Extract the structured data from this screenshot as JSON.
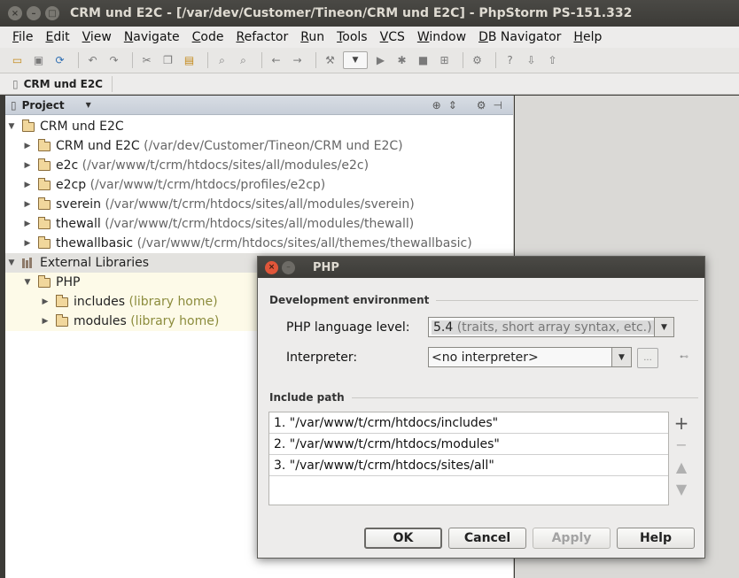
{
  "window": {
    "title": "CRM und E2C - [/var/dev/Customer/Tineon/CRM und E2C] - PhpStorm PS-151.332"
  },
  "menu": [
    "File",
    "Edit",
    "View",
    "Navigate",
    "Code",
    "Refactor",
    "Run",
    "Tools",
    "VCS",
    "Window",
    "DB Navigator",
    "Help"
  ],
  "navbar": {
    "crumb": "CRM und E2C"
  },
  "project_panel": {
    "title": "Project",
    "root": "CRM und E2C",
    "items": [
      {
        "name": "CRM und E2C",
        "path": "(/var/dev/Customer/Tineon/CRM und E2C)"
      },
      {
        "name": "e2c",
        "path": "(/var/www/t/crm/htdocs/sites/all/modules/e2c)"
      },
      {
        "name": "e2cp",
        "path": "(/var/www/t/crm/htdocs/profiles/e2cp)"
      },
      {
        "name": "sverein",
        "path": "(/var/www/t/crm/htdocs/sites/all/modules/sverein)"
      },
      {
        "name": "thewall",
        "path": "(/var/www/t/crm/htdocs/sites/all/modules/thewall)"
      },
      {
        "name": "thewallbasic",
        "path": "(/var/www/t/crm/htdocs/sites/all/themes/thewallbasic)"
      }
    ],
    "external_libraries": "External Libraries",
    "php": "PHP",
    "php_children": [
      {
        "name": "includes",
        "note": "(library home)"
      },
      {
        "name": "modules",
        "note": "(library home)"
      }
    ]
  },
  "dialog": {
    "title": "PHP",
    "dev_env_section": "Development environment",
    "language_level_label": "PHP language level:",
    "language_level_value": "5.4",
    "language_level_note": "(traits, short array syntax, etc.)",
    "interpreter_label": "Interpreter:",
    "interpreter_value": "<no interpreter>",
    "dots_label": "...",
    "include_path_section": "Include path",
    "include_paths": [
      "1. \"/var/www/t/crm/htdocs/includes\"",
      "2. \"/var/www/t/crm/htdocs/modules\"",
      "3. \"/var/www/t/crm/htdocs/sites/all\""
    ],
    "buttons": {
      "ok": "OK",
      "cancel": "Cancel",
      "apply": "Apply",
      "help": "Help"
    }
  }
}
